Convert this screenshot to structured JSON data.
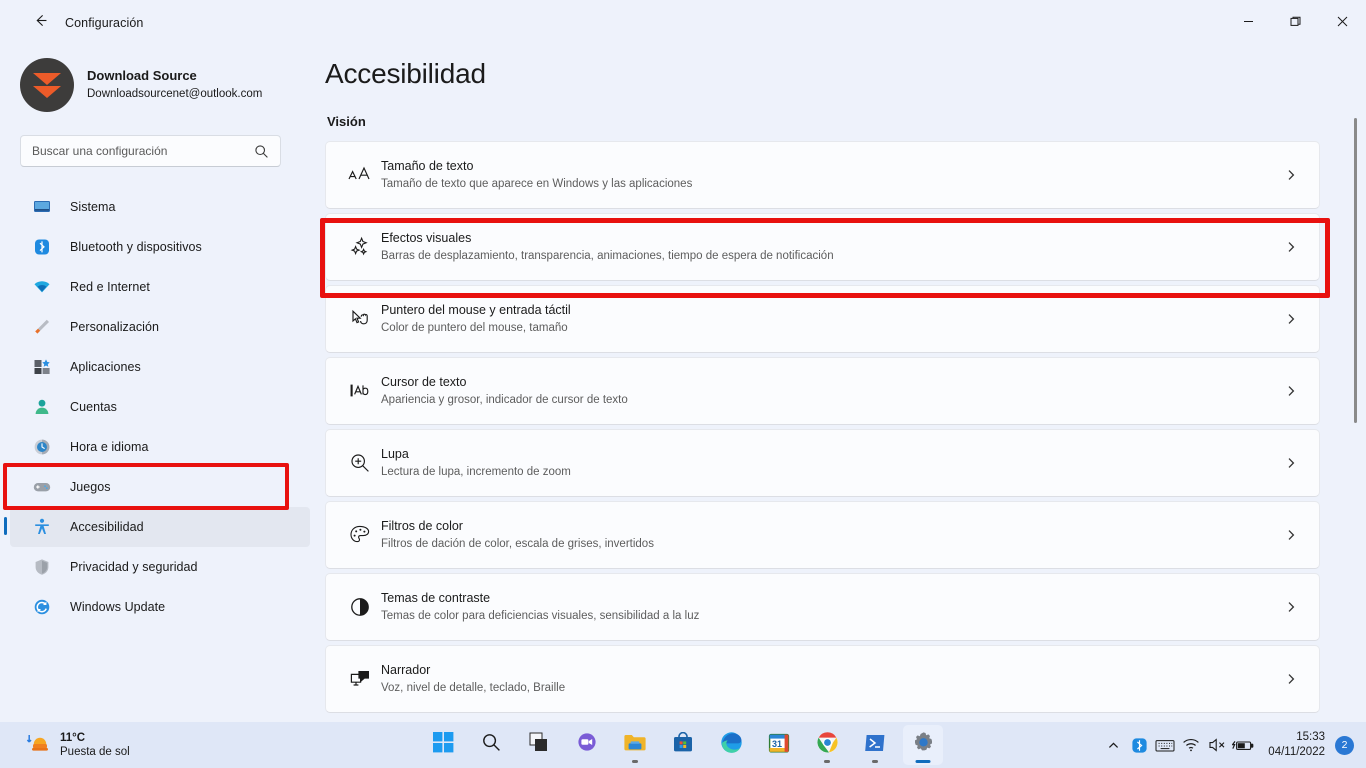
{
  "window": {
    "title": "Configuración",
    "back_icon": "arrow-left-icon",
    "minimize_label": "Minimizar",
    "maximize_label": "Maximizar",
    "close_label": "Cerrar"
  },
  "profile": {
    "name": "Download Source",
    "email": "Downloadsourcenet@outlook.com"
  },
  "search": {
    "placeholder": "Buscar una configuración",
    "value": "",
    "icon": "search-icon"
  },
  "sidebar": {
    "items": [
      {
        "label": "Sistema",
        "icon": "monitor-icon",
        "active": false
      },
      {
        "label": "Bluetooth y dispositivos",
        "icon": "bluetooth-icon",
        "active": false
      },
      {
        "label": "Red e Internet",
        "icon": "wifi-icon",
        "active": false
      },
      {
        "label": "Personalización",
        "icon": "brush-icon",
        "active": false
      },
      {
        "label": "Aplicaciones",
        "icon": "apps-icon",
        "active": false
      },
      {
        "label": "Cuentas",
        "icon": "person-icon",
        "active": false
      },
      {
        "label": "Hora e idioma",
        "icon": "clock-icon",
        "active": false
      },
      {
        "label": "Juegos",
        "icon": "gamepad-icon",
        "active": false
      },
      {
        "label": "Accesibilidad",
        "icon": "accessibility-icon",
        "active": true
      },
      {
        "label": "Privacidad y seguridad",
        "icon": "shield-icon",
        "active": false
      },
      {
        "label": "Windows Update",
        "icon": "update-icon",
        "active": false
      }
    ]
  },
  "main": {
    "page_title": "Accesibilidad",
    "section_title": "Visión",
    "rows": [
      {
        "title": "Tamaño de texto",
        "subtitle": "Tamaño de texto que aparece en Windows y las aplicaciones",
        "icon": "text-size-icon",
        "highlighted": false
      },
      {
        "title": "Efectos visuales",
        "subtitle": "Barras de desplazamiento, transparencia, animaciones, tiempo de espera de notificación",
        "icon": "sparkle-icon",
        "highlighted": true
      },
      {
        "title": "Puntero del mouse y entrada táctil",
        "subtitle": "Color de puntero del mouse, tamaño",
        "icon": "mouse-pointer-icon",
        "highlighted": false
      },
      {
        "title": "Cursor de texto",
        "subtitle": "Apariencia y grosor, indicador de cursor de texto",
        "icon": "text-cursor-icon",
        "highlighted": false
      },
      {
        "title": "Lupa",
        "subtitle": "Lectura de lupa, incremento de zoom",
        "icon": "magnifier-icon",
        "highlighted": false
      },
      {
        "title": "Filtros de color",
        "subtitle": "Filtros de dación de color, escala de grises, invertidos",
        "icon": "palette-icon",
        "highlighted": false
      },
      {
        "title": "Temas de contraste",
        "subtitle": "Temas de color para deficiencias visuales, sensibilidad a la luz",
        "icon": "contrast-icon",
        "highlighted": false
      },
      {
        "title": "Narrador",
        "subtitle": "Voz, nivel de detalle, teclado, Braille",
        "icon": "narrator-icon",
        "highlighted": false
      }
    ],
    "chevron_icon": "chevron-right-icon"
  },
  "taskbar": {
    "weather": {
      "temperature": "11°C",
      "description": "Puesta de sol",
      "icon": "sunset-icon"
    },
    "apps": [
      {
        "name": "start-button",
        "icon": "windows-logo-icon",
        "running": false
      },
      {
        "name": "search-button",
        "icon": "search-icon",
        "running": false
      },
      {
        "name": "task-view-button",
        "icon": "task-view-icon",
        "running": false
      },
      {
        "name": "chat-button",
        "icon": "chat-icon",
        "running": false
      },
      {
        "name": "file-explorer",
        "icon": "folder-icon",
        "running": true
      },
      {
        "name": "microsoft-store",
        "icon": "store-icon",
        "running": false
      },
      {
        "name": "microsoft-edge",
        "icon": "edge-icon",
        "running": false
      },
      {
        "name": "calendar-app",
        "icon": "calendar-icon",
        "running": false
      },
      {
        "name": "google-chrome",
        "icon": "chrome-icon",
        "running": true
      },
      {
        "name": "powershell",
        "icon": "powershell-icon",
        "running": true
      },
      {
        "name": "settings-app",
        "icon": "gear-icon",
        "running": true
      }
    ],
    "tray": {
      "overflow_icon": "chevron-up-icon",
      "bluetooth_icon": "bluetooth-icon",
      "keyboard_icon": "keyboard-icon",
      "network_icon": "wifi-icon",
      "volume_icon": "speaker-muted-icon",
      "battery_icon": "battery-charging-icon",
      "time": "15:33",
      "date": "04/11/2022",
      "notification_count": "2"
    }
  },
  "colors": {
    "accent": "#0f6cbd",
    "annotation": "#e8110f",
    "background": "#eef2fb",
    "card": "#fbfcfe",
    "taskbar": "#dfe7f7"
  }
}
